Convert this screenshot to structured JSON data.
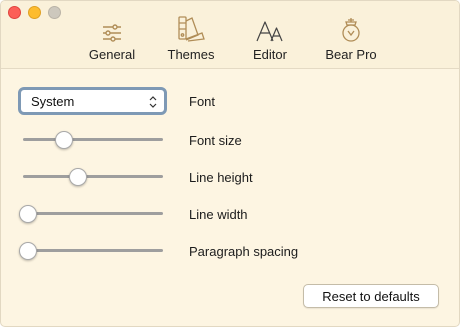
{
  "toolbar": {
    "tabs": [
      {
        "label": "General",
        "icon": "sliders-icon"
      },
      {
        "label": "Themes",
        "icon": "swatches-icon"
      },
      {
        "label": "Editor",
        "icon": "font-aa-icon"
      },
      {
        "label": "Bear Pro",
        "icon": "bear-pro-icon"
      }
    ]
  },
  "settings": {
    "font": {
      "selected": "System",
      "label": "Font"
    },
    "font_size": {
      "label": "Font size",
      "level": 0.28
    },
    "line_height": {
      "label": "Line height",
      "level": 0.39
    },
    "line_width": {
      "label": "Line width",
      "level": 0.0
    },
    "paragraph_spacing": {
      "label": "Paragraph spacing",
      "level": 0.0
    }
  },
  "reset_label": "Reset to defaults",
  "colors": {
    "background": "#fdf5e2",
    "toolbar": "#faf1da",
    "icon_accent": "#b08d57",
    "select_border": "#7e99b5"
  }
}
